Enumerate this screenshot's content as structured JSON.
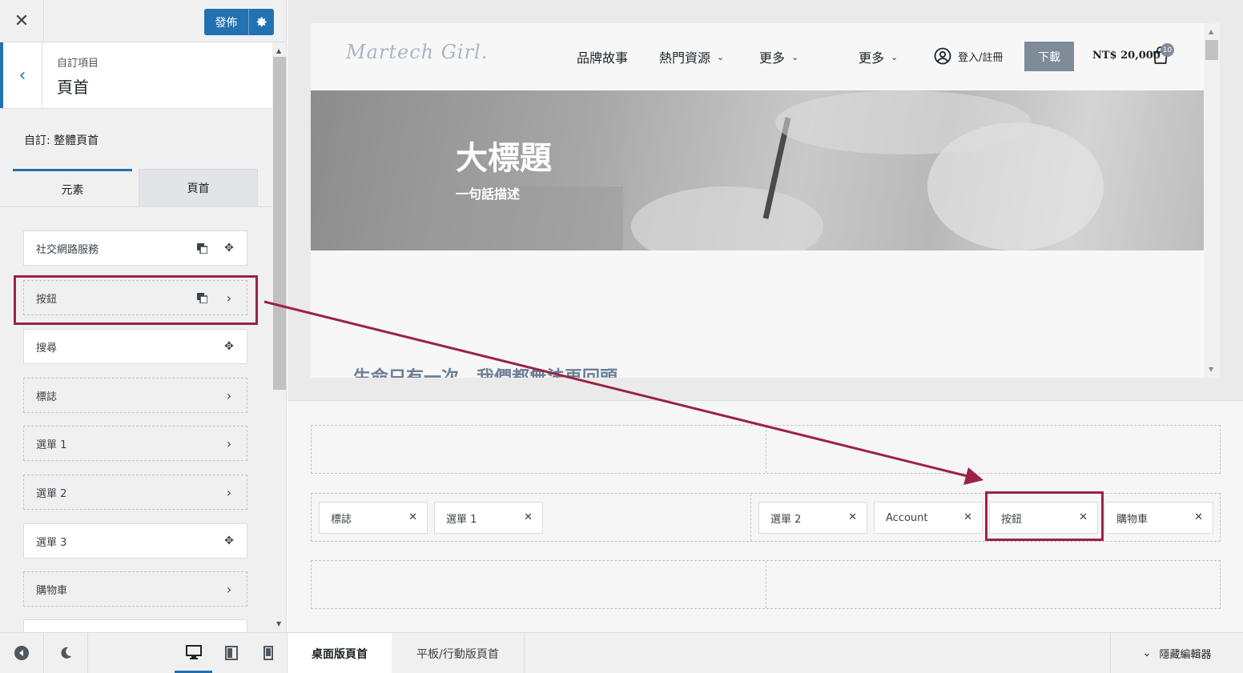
{
  "sidebar": {
    "publish_label": "發佈",
    "breadcrumb_small": "自訂項目",
    "breadcrumb_title": "頁首",
    "customize_label": "自訂: 整體頁首",
    "tabs": [
      {
        "label": "元素"
      },
      {
        "label": "頁首"
      }
    ],
    "elements": [
      {
        "label": "社交網路服務"
      },
      {
        "label": "按鈕"
      },
      {
        "label": "搜尋"
      },
      {
        "label": "標誌"
      },
      {
        "label": "選單 1"
      },
      {
        "label": "選單 2"
      },
      {
        "label": "選單 3"
      },
      {
        "label": "購物車"
      }
    ]
  },
  "preview": {
    "logo_text": "Martech Girl.",
    "nav": [
      {
        "label": "品牌故事"
      },
      {
        "label": "熱門資源"
      },
      {
        "label": "更多"
      },
      {
        "label": "更多"
      }
    ],
    "login_label": "登入/註冊",
    "download_label": "下載",
    "price": "NT$ 20,000",
    "cart_count": "10",
    "hero_title": "大標題",
    "hero_subtitle": "一句話描述",
    "section_text": "生命只有一次，我們都無法再回頭"
  },
  "builder": {
    "middle_row": {
      "left": [
        {
          "label": "標誌"
        },
        {
          "label": "選單 1"
        }
      ],
      "right": [
        {
          "label": "選單 2"
        },
        {
          "label": "Account"
        },
        {
          "label": "按鈕"
        },
        {
          "label": "購物車"
        }
      ]
    }
  },
  "footer": {
    "tab_desktop": "桌面版頁首",
    "tab_mobile": "平板/行動版頁首",
    "hide_editor": "隱藏編輯器"
  },
  "colors": {
    "accent": "#2271b1",
    "highlight": "#9b2345",
    "download_button": "#7e8b99"
  }
}
